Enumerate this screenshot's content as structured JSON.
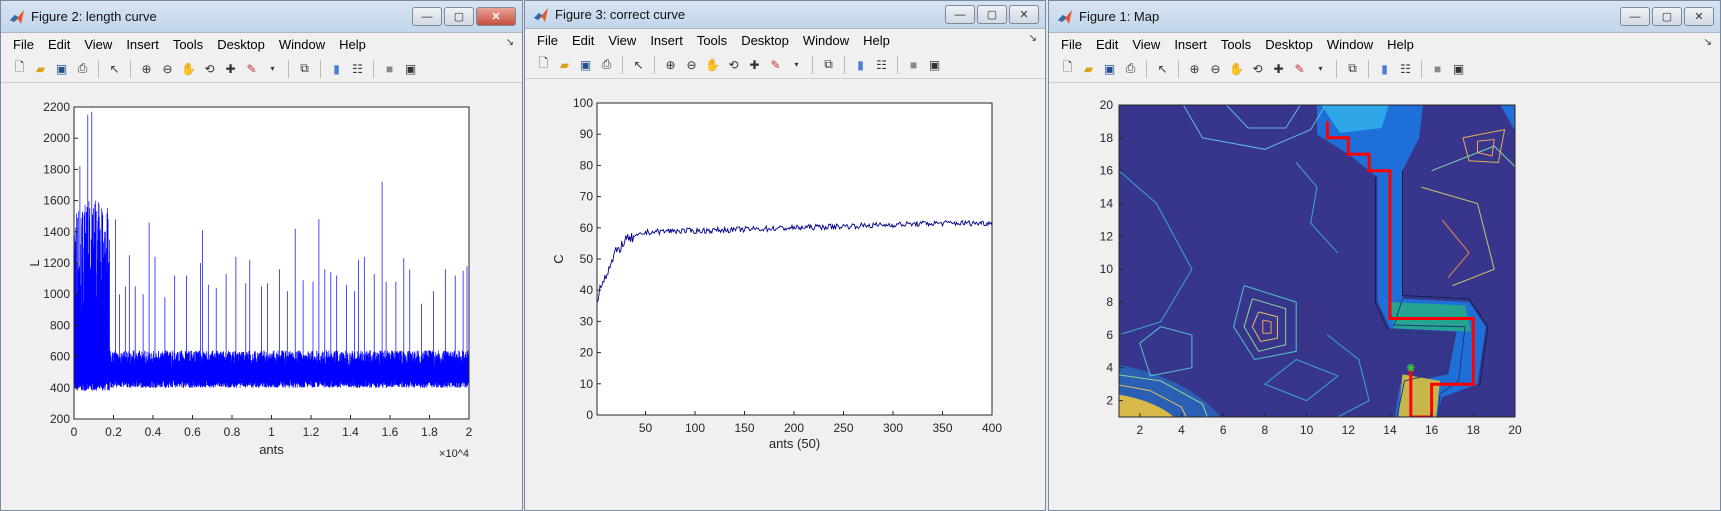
{
  "windows": [
    {
      "title": "Figure 2: length curve",
      "menus": [
        "File",
        "Edit",
        "View",
        "Insert",
        "Tools",
        "Desktop",
        "Window",
        "Help"
      ]
    },
    {
      "title": "Figure 3: correct curve",
      "menus": [
        "File",
        "Edit",
        "View",
        "Insert",
        "Tools",
        "Desktop",
        "Window",
        "Help"
      ]
    },
    {
      "title": "Figure 1: Map",
      "menus": [
        "File",
        "Edit",
        "View",
        "Insert",
        "Tools",
        "Desktop",
        "Window",
        "Help"
      ]
    }
  ],
  "window_controls": {
    "minimize": "—",
    "maximize": "▢",
    "close": "✕"
  },
  "toolbar_icons": [
    "new-file-icon",
    "open-folder-icon",
    "save-icon",
    "print-icon",
    "pointer-icon",
    "zoom-in-icon",
    "zoom-out-icon",
    "pan-hand-icon",
    "rotate-3d-icon",
    "data-cursor-icon",
    "brush-icon",
    "link-plot-icon",
    "colorbar-icon",
    "legend-icon",
    "hide-plot-tools-icon",
    "show-plot-tools-icon"
  ],
  "chart_data": [
    {
      "type": "line",
      "xlabel": "ants",
      "ylabel": "L",
      "x_multiplier": "×10^4",
      "xlim": [
        0,
        20000
      ],
      "ylim": [
        200,
        2200
      ],
      "xticks": [
        "0",
        "0.2",
        "0.4",
        "0.6",
        "0.8",
        "1",
        "1.2",
        "1.4",
        "1.6",
        "1.8",
        "2"
      ],
      "yticks": [
        "200",
        "400",
        "600",
        "800",
        "1000",
        "1200",
        "1400",
        "1600",
        "1800",
        "2000",
        "2200"
      ],
      "series": [
        {
          "values_summary": "noisy length per ant; dense band 380–1600 for first ~1800 ants, then baseline ~420–560 with spikes up to ~1720",
          "color": "#0000ff",
          "spikes": [
            [
              300,
              1820
            ],
            [
              500,
              1300
            ],
            [
              700,
              2150
            ],
            [
              900,
              2170
            ],
            [
              1100,
              1600
            ],
            [
              1400,
              1550
            ],
            [
              1600,
              1400
            ],
            [
              1800,
              1350
            ],
            [
              2100,
              1480
            ],
            [
              2300,
              1000
            ],
            [
              2600,
              1050
            ],
            [
              2800,
              1250
            ],
            [
              3100,
              1050
            ],
            [
              3500,
              1000
            ],
            [
              3800,
              1460
            ],
            [
              4100,
              1240
            ],
            [
              4600,
              980
            ],
            [
              5100,
              1120
            ],
            [
              5700,
              1120
            ],
            [
              6400,
              1200
            ],
            [
              6500,
              1410
            ],
            [
              6800,
              1060
            ],
            [
              7200,
              1040
            ],
            [
              7700,
              1130
            ],
            [
              8200,
              1240
            ],
            [
              8700,
              1070
            ],
            [
              8900,
              1220
            ],
            [
              9500,
              1050
            ],
            [
              9800,
              1070
            ],
            [
              10400,
              1160
            ],
            [
              10800,
              1020
            ],
            [
              11200,
              1420
            ],
            [
              11600,
              1090
            ],
            [
              12100,
              1080
            ],
            [
              12400,
              1480
            ],
            [
              12700,
              1160
            ],
            [
              13000,
              1140
            ],
            [
              13300,
              1120
            ],
            [
              13800,
              1060
            ],
            [
              14200,
              1020
            ],
            [
              14400,
              1220
            ],
            [
              14700,
              1240
            ],
            [
              15200,
              1130
            ],
            [
              15600,
              1720
            ],
            [
              15800,
              1080
            ],
            [
              16300,
              1080
            ],
            [
              16700,
              1230
            ],
            [
              17000,
              1160
            ],
            [
              17600,
              940
            ],
            [
              18200,
              1020
            ],
            [
              18800,
              1160
            ],
            [
              19300,
              1120
            ],
            [
              19700,
              1150
            ],
            [
              19900,
              1180
            ]
          ]
        }
      ]
    },
    {
      "type": "line",
      "xlabel": "ants (50)",
      "ylabel": "C",
      "xlim": [
        1,
        400
      ],
      "ylim": [
        0,
        100
      ],
      "xticks": [
        "50",
        "100",
        "150",
        "200",
        "250",
        "300",
        "350",
        "400"
      ],
      "yticks": [
        "0",
        "10",
        "20",
        "30",
        "40",
        "50",
        "60",
        "70",
        "80",
        "90",
        "100"
      ],
      "series": [
        {
          "values_summary": "correct count per 50 ants; rises from ~37 at x=1 to ~56 by x=30, ~59 by x=60, plateau ~59–62 to x=400",
          "color": "#00008b",
          "anchors": [
            [
              1,
              37
            ],
            [
              5,
              42
            ],
            [
              10,
              45
            ],
            [
              15,
              48
            ],
            [
              20,
              52
            ],
            [
              25,
              54
            ],
            [
              30,
              56
            ],
            [
              40,
              57
            ],
            [
              50,
              58.5
            ],
            [
              75,
              59
            ],
            [
              100,
              59
            ],
            [
              150,
              59.5
            ],
            [
              200,
              60
            ],
            [
              250,
              60.5
            ],
            [
              300,
              61
            ],
            [
              350,
              61.5
            ],
            [
              400,
              61.5
            ]
          ]
        }
      ]
    },
    {
      "type": "contour",
      "title": "",
      "xlim": [
        1,
        20
      ],
      "ylim": [
        1,
        20
      ],
      "xticks": [
        "2",
        "4",
        "6",
        "8",
        "10",
        "12",
        "14",
        "16",
        "18",
        "20"
      ],
      "yticks": [
        "2",
        "4",
        "6",
        "8",
        "10",
        "12",
        "14",
        "16",
        "18",
        "20"
      ],
      "background_color": "#38358c",
      "path_color": "#ff0000",
      "path": [
        [
          11,
          19
        ],
        [
          11,
          18
        ],
        [
          12,
          18
        ],
        [
          12,
          17
        ],
        [
          13,
          17
        ],
        [
          13,
          16
        ],
        [
          14,
          16
        ],
        [
          14,
          7
        ],
        [
          18,
          7
        ],
        [
          18,
          3
        ],
        [
          16,
          3
        ],
        [
          16,
          1
        ],
        [
          15,
          1
        ],
        [
          15,
          4
        ]
      ],
      "start_marker": [
        15,
        4
      ]
    }
  ]
}
